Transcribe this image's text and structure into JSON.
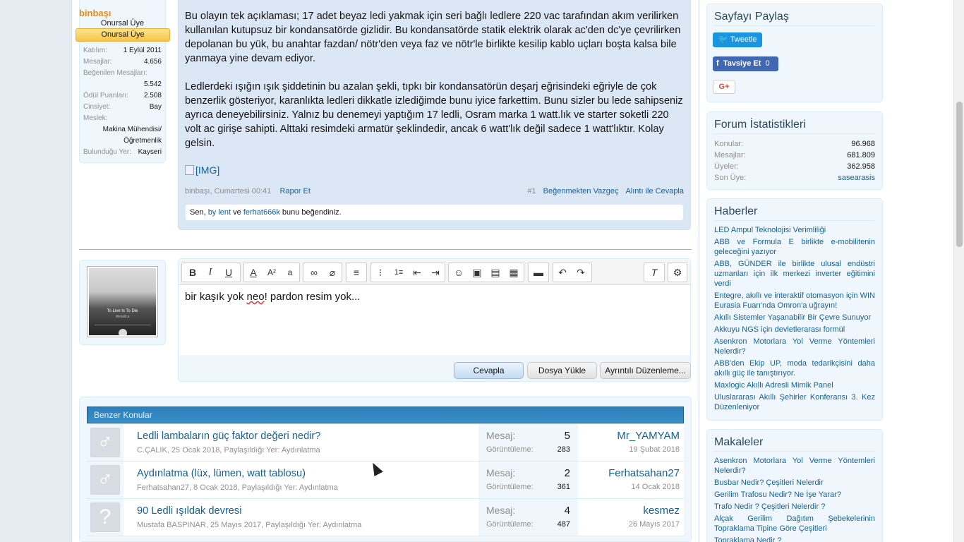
{
  "post": {
    "username": "binbaşı",
    "user_title": "Onursal Üye",
    "user_banner": "Onursal Üye",
    "stats": [
      {
        "k": "Katılım:",
        "v": "1 Eylül 2011"
      },
      {
        "k": "Mesajlar:",
        "v": "4.656"
      },
      {
        "k": "Beğenilen Mesajları:",
        "v": "5.542"
      },
      {
        "k": "Ödül Puanları:",
        "v": "2.508"
      },
      {
        "k": "Cinsiyet:",
        "v": "Bay"
      },
      {
        "k": "Meslek:",
        "v": "Makina Mühendisi/ Öğretmenlik"
      },
      {
        "k": "Bulunduğu Yer:",
        "v": "Kayseri"
      }
    ],
    "paragraph1": "Bu olayın tek açıklaması; 17 adet beyaz ledi yakmak için seri bağlı ledlere 220 vac tarafından akım verilirken kullanılan kutupsuz bir kondansatörde gizlidir. Bu kondansatörde statik elektrik olarak ac'den dc'ye çevrilirken depolanan bu yük, bu anahtar fazdan/ nötr'den veya faz ve nötr'le birlikte kesilip kablo uçları boşta kalsa bile yanmaya yine devam ediyor.",
    "paragraph2": "Ledlerdeki ışığın ışık şiddetinin bu azalan şekli, tıpkı bir kondansatörün deşarj eğrisindeki eğriyle de çok benzerlik gösteriyor, karanlıkta ledleri dikkatle izlediğimde bunu iyice farkettim. Bunu sizler bu lede sahipseniz ayrıca deneyebilirsiniz. Yalnız bu denemeyi yaptığım 17 ledli, Osram marka 1 watt.lık ve starter soketli 220 volt ac girişe sahipti. Alttaki resimdeki armatür şeklindedir, ancak 6 watt'lık değil sadece 1 watt'lıktır. Kolay gelsin.",
    "img_alt": "[IMG]",
    "meta_author_date": "binbaşı, Cumartesi 00:41",
    "report_label": "Rapor Et",
    "post_number": "#1",
    "unlike_label": "Beğenmekten Vazgeç",
    "quote_label": "Alıntı ile Cevapla",
    "likes_prefix": "Sen, ",
    "likes_user1": "by lent",
    "likes_and": " ve ",
    "likes_user2": "ferhat666k",
    "likes_suffix": " bunu beğendiniz."
  },
  "reply": {
    "avatar_title": "To Live Is To Die",
    "avatar_sub": "Metallica",
    "text_before": "bir kaşık yok ",
    "text_misspelled": "neo",
    "text_after": "! pardon resim yok...",
    "btn_reply": "Cevapla",
    "btn_upload": "Dosya Yükle",
    "btn_advanced": "Ayrıntılı Düzenleme..."
  },
  "similar": {
    "header": "Benzer Konular",
    "msg_label": "Mesaj:",
    "views_label": "Görüntüleme:",
    "rows": [
      {
        "icon": "♂",
        "title": "Ledli lambaların güç faktor değeri nedir?",
        "sub": "C.ÇALIK, 25 Ocak 2018, Paylaşıldığı Yer: Aydınlatma",
        "msgs": "5",
        "views": "283",
        "last": "Mr_YAMYAM",
        "date": "19 Şubat 2018"
      },
      {
        "icon": "♂",
        "title": "Aydınlatma (lüx, lümen, watt tablosu)",
        "sub": "Ferhatsahan27, 8 Ocak 2018, Paylaşıldığı Yer: Aydınlatma",
        "msgs": "2",
        "views": "361",
        "last": "Ferhatsahan27",
        "date": "14 Ocak 2018"
      },
      {
        "icon": "?",
        "title": "90 Ledli ışıldak devresi",
        "sub": "Mustafa BASPINAR, 25 Mayıs 2017, Paylaşıldığı Yer: Aydınlatma",
        "msgs": "4",
        "views": "487",
        "last": "kesmez",
        "date": "26 Mayıs 2017"
      }
    ]
  },
  "sidebar": {
    "share_title": "Sayfayı Paylaş",
    "tweet_label": "Tweetle",
    "fb_label": "Tavsiye Et",
    "fb_count": "0",
    "gplus_label": "G+",
    "stats_title": "Forum İstatistikleri",
    "stats": [
      {
        "k": "Konular:",
        "v": "96.968"
      },
      {
        "k": "Mesajlar:",
        "v": "681.809"
      },
      {
        "k": "Üyeler:",
        "v": "362.958"
      },
      {
        "k": "Son Üye:",
        "v": "sasearasis"
      }
    ],
    "news_title": "Haberler",
    "news": [
      "LED Ampul Teknolojisi Verimliliği",
      "ABB ve Formula E birlikte e-mobilitenin geleceğini yazıyor",
      "ABB, GÜNDER ile birlikte ulusal endüstri uzmanları için ilk merkezi inverter eğitimini verdi",
      "Entegre, akıllı ve interaktif otomasyon için WIN Eurasia Fuarı'nda Omron'a uğrayın!",
      "Akıllı Sistemler Yaşanabilir Bir Çevre Sunuyor",
      "Akkuyu NGS için devletlerarası formül",
      "Asenkron Motorlara Yol Verme Yöntemleri Nelerdir?",
      "ABB'den Ekip UP, moda tedarikçisini daha akıllı güç ile tanıştırıyor.",
      "Maxlogic Akıllı Adresli Mimik Panel",
      "Uluslararası Akıllı Şehirler Konferansı 3. Kez Düzenleniyor"
    ],
    "articles_title": "Makaleler",
    "articles": [
      "Asenkron Motorlara Yol Verme Yöntemleri Nelerdir?",
      "Busbar Nedir? Çeşitleri Nelerdir",
      "Gerilim Trafosu Nedir? Ne İşe Yarar?",
      "Trafo Nedir ? Çeşitleri Nelerdir ?",
      "Alçak Gerilim Dağıtım Şebekelerinin Topraklama Tipine Göre Çeşitleri",
      "Topraklama Nedir ?"
    ]
  }
}
